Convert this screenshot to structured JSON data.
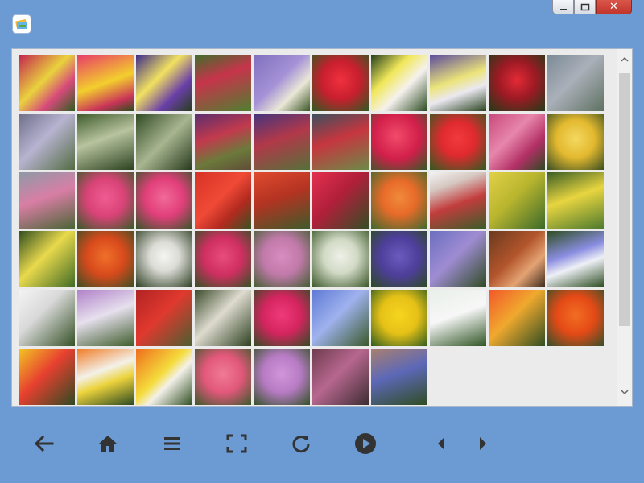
{
  "window": {
    "controls": [
      {
        "name": "minimize-button",
        "icon": "minimize-icon"
      },
      {
        "name": "maximize-button",
        "icon": "maximize-icon"
      },
      {
        "name": "close-button",
        "icon": "close-icon"
      }
    ]
  },
  "app_icon": "photo-gallery-icon",
  "gallery": {
    "tiles": [
      {
        "bg": "linear-gradient(135deg,#c2224f 0%,#e9d23e 45%,#d74a7a 70%,#2f5d1f 100%)"
      },
      {
        "bg": "linear-gradient(160deg,#e83b68 0%,#f3cf2d 50%,#c93458 80%,#2b4d1c 100%)"
      },
      {
        "bg": "linear-gradient(135deg,#3c2b8a 0%,#f1e160 40%,#6a3fa9 70%,#263e1b 100%)"
      },
      {
        "bg": "linear-gradient(160deg,#3f6e2a 0%,#c7344b 40%,#4f7f31 100%)"
      },
      {
        "bg": "linear-gradient(135deg,#7f6fbd 0%,#a491d6 45%,#eae7d6 70%,#3b5626 100%)"
      },
      {
        "bg": "radial-gradient(circle at 50% 45%,#f0303f 0%,#c81f2e 45%,#2e5a22 100%)"
      },
      {
        "bg": "linear-gradient(135deg,#243f1e 0%,#f1e85a 35%,#f5f1ee 60%,#2a4a20 100%)"
      },
      {
        "bg": "linear-gradient(160deg,#5b4a9d 0%,#ece47a 45%,#ebe8f1 65%,#2a4420 100%)"
      },
      {
        "bg": "radial-gradient(circle at 50% 45%,#e32a36 0%,#9c1a24 45%,#213b18 100%)"
      },
      {
        "bg": "linear-gradient(135deg,#7b8a96 0%,#aab0b9 45%,#5f7163 100%)"
      },
      {
        "bg": "linear-gradient(135deg,#6e6f8a 0%,#b7b3d0 45%,#536c43 100%)"
      },
      {
        "bg": "linear-gradient(160deg,#3d5b2a 0%,#b8c39f 45%,#2c4220 100%)"
      },
      {
        "bg": "linear-gradient(135deg,#2f4a24 0%,#a8b590 50%,#26391c 100%)"
      },
      {
        "bg": "linear-gradient(160deg,#5a2d6e 0%,#c23a4d 40%,#6c7a3b 70%,#5f4c37 100%)"
      },
      {
        "bg": "linear-gradient(160deg,#43357e 0%,#b23849 45%,#55713a 100%)"
      },
      {
        "bg": "linear-gradient(160deg,#3b4f5e 0%,#c6363f 45%,#6c8a48 100%)"
      },
      {
        "bg": "radial-gradient(circle at 45% 40%,#f24a6a 0%,#d11f4a 50%,#2e5d25 100%)"
      },
      {
        "bg": "radial-gradient(circle at 50% 45%,#f13a3d 0%,#e02a2f 40%,#2f5b21 100%)"
      },
      {
        "bg": "linear-gradient(135deg,#c7487b 0%,#e786ab 40%,#b23065 70%,#2d4920 100%)"
      },
      {
        "bg": "radial-gradient(circle at 50% 45%,#f4d860 0%,#e3b92f 45%,#3a4e22 100%)"
      },
      {
        "bg": "linear-gradient(160deg,#8d9aa6 0%,#d97ea5 45%,#4b6536 100%)"
      },
      {
        "bg": "radial-gradient(circle at 50% 45%,#f05c92 0%,#d94377 45%,#3b5a2a 100%)"
      },
      {
        "bg": "radial-gradient(circle at 50% 45%,#f06a98 0%,#e23f7a 45%,#37562a 100%)"
      },
      {
        "bg": "linear-gradient(135deg,#d63224 0%,#f04a37 45%,#b22a1f 70%,#3a5223 100%)"
      },
      {
        "bg": "linear-gradient(160deg,#e04b2e 0%,#b43322 45%,#3f5a2a 100%)"
      },
      {
        "bg": "linear-gradient(135deg,#e3304f 0%,#b11f3a 45%,#344e25 100%)"
      },
      {
        "bg": "radial-gradient(circle at 50% 45%,#f08a3a 0%,#e86b2a 40%,#3f6a2d 100%)"
      },
      {
        "bg": "linear-gradient(160deg,#f3f3f3 0%,#d6c7c1 25%,#c23d3d 55%,#3a5d2a 100%)"
      },
      {
        "bg": "linear-gradient(135deg,#e1d148 0%,#b9b52e 45%,#3c6a2a 100%)"
      },
      {
        "bg": "linear-gradient(160deg,#3b5e25 0%,#e8d540 45%,#4e7a2e 100%)"
      },
      {
        "bg": "linear-gradient(135deg,#2e4d1f 0%,#e9d94c 45%,#3f6a25 100%)"
      },
      {
        "bg": "radial-gradient(circle at 50% 45%,#f0702a 0%,#d84a1c 45%,#3b4e23 100%)"
      },
      {
        "bg": "radial-gradient(circle at 50% 45%,#f4f4f2 0%,#dcdcd6 35%,#2c3d22 100%)"
      },
      {
        "bg": "radial-gradient(circle at 50% 45%,#e84d7c 0%,#cf2f61 45%,#2f5322 100%)"
      },
      {
        "bg": "radial-gradient(circle at 50% 45%,#d98cc0 0%,#c07aa9 45%,#415e2f 100%)"
      },
      {
        "bg": "radial-gradient(circle at 50% 45%,#eef1e7 0%,#d2dac6 40%,#3a5728 100%)"
      },
      {
        "bg": "radial-gradient(circle at 50% 45%,#6b5bbd 0%,#4e3f9c 45%,#2c4a20 100%)"
      },
      {
        "bg": "linear-gradient(135deg,#6a6fbf 0%,#9f8cd3 45%,#2e4b22 100%)"
      },
      {
        "bg": "linear-gradient(135deg,#6a3a1e 0%,#b2552c 45%,#e4a373 70%,#3d2a1e 100%)"
      },
      {
        "bg": "linear-gradient(160deg,#2e4e22 0%,#8a8de0 40%,#eef0f6 60%,#2b4b1f 100%)"
      },
      {
        "bg": "linear-gradient(135deg,#f4f4f4 0%,#d9d9d9 40%,#355126 100%)"
      },
      {
        "bg": "linear-gradient(160deg,#b081c9 0%,#e6e0ed 45%,#3f5d2c 100%)"
      },
      {
        "bg": "linear-gradient(135deg,#b02323 0%,#e0392e 45%,#4a5f32 100%)"
      },
      {
        "bg": "linear-gradient(135deg,#3a4a2a 0%,#dedbcf 45%,#2c3f1f 100%)"
      },
      {
        "bg": "radial-gradient(circle at 50% 45%,#f03a7a 0%,#d4255f 45%,#2e4d22 100%)"
      },
      {
        "bg": "linear-gradient(135deg,#5e7ad5 0%,#9fb2ee 45%,#3a5a2a 100%)"
      },
      {
        "bg": "radial-gradient(circle at 50% 45%,#f6d51f 0%,#e5c117 45%,#2d5b1f 100%)"
      },
      {
        "bg": "linear-gradient(160deg,#e8efe9 0%,#f7f7f7 45%,#2f5524 100%)"
      },
      {
        "bg": "linear-gradient(135deg,#f2562a 0%,#f0a92e 45%,#2f4d22 100%)"
      },
      {
        "bg": "radial-gradient(circle at 50% 45%,#f16e22 0%,#e54a16 45%,#33502a 100%)"
      },
      {
        "bg": "linear-gradient(135deg,#f3c624 0%,#e7402f 45%,#2f4a23 100%)"
      },
      {
        "bg": "linear-gradient(160deg,#f07b24 0%,#f3f1e9 40%,#ecd33c 60%,#2d4a20 100%)"
      },
      {
        "bg": "linear-gradient(135deg,#ef6d1c 0%,#f4dc3c 45%,#f3f1e9 60%,#2f4e22 100%)"
      },
      {
        "bg": "radial-gradient(circle at 50% 45%,#f07a96 0%,#e2587a 45%,#3a5a2a 100%)"
      },
      {
        "bg": "radial-gradient(circle at 50% 45%,#d195da 0%,#b67bc3 45%,#325226 100%)"
      },
      {
        "bg": "linear-gradient(135deg,#6e3b4f 0%,#b7678e 45%,#3d2d33 100%)"
      },
      {
        "bg": "linear-gradient(160deg,#a9806e 0%,#5c68b8 45%,#2f4d22 100%)"
      }
    ],
    "scrollbar": {
      "up_icon": "chevron-up-icon",
      "down_icon": "chevron-down-icon"
    }
  },
  "toolbar": {
    "buttons": [
      {
        "name": "back-button",
        "icon": "arrow-left-icon"
      },
      {
        "name": "home-button",
        "icon": "home-icon"
      },
      {
        "name": "menu-button",
        "icon": "menu-icon"
      },
      {
        "name": "fullscreen-button",
        "icon": "fullscreen-icon"
      },
      {
        "name": "refresh-button",
        "icon": "refresh-icon"
      },
      {
        "name": "play-button",
        "icon": "play-icon"
      },
      {
        "name": "previous-button",
        "icon": "triangle-left-icon"
      },
      {
        "name": "next-button",
        "icon": "triangle-right-icon"
      }
    ],
    "icon_color": "#333333"
  }
}
